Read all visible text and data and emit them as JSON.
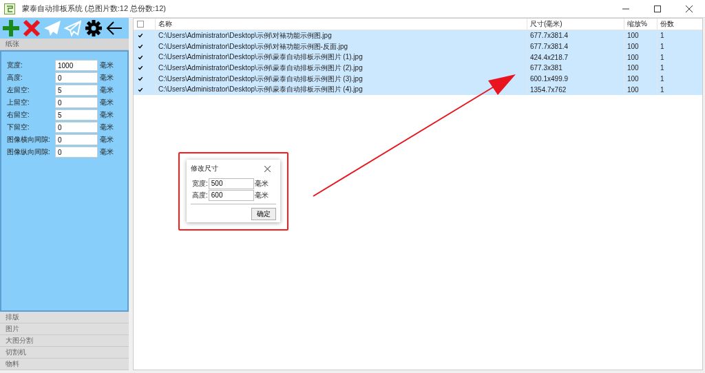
{
  "window": {
    "title": "蒙泰自动排板系统 (总图片数:12 总份数:12)"
  },
  "sidebar": {
    "sections": [
      {
        "label": "纸张",
        "expanded": true,
        "fields": [
          {
            "label": "宽度:",
            "value": "1000",
            "unit": "毫米"
          },
          {
            "label": "高度:",
            "value": "0",
            "unit": "毫米"
          },
          {
            "label": "左留空:",
            "value": "5",
            "unit": "毫米"
          },
          {
            "label": "上留空:",
            "value": "0",
            "unit": "毫米"
          },
          {
            "label": "右留空:",
            "value": "5",
            "unit": "毫米"
          },
          {
            "label": "下留空:",
            "value": "0",
            "unit": "毫米"
          },
          {
            "label": "图像横向间隙:",
            "value": "0",
            "unit": "毫米"
          },
          {
            "label": "图像纵向间隙:",
            "value": "0",
            "unit": "毫米"
          }
        ]
      },
      {
        "label": "排版",
        "expanded": false
      },
      {
        "label": "图片",
        "expanded": false
      },
      {
        "label": "大图分割",
        "expanded": false
      },
      {
        "label": "切割机",
        "expanded": false
      },
      {
        "label": "物料",
        "expanded": false
      }
    ]
  },
  "table": {
    "all_checked": false,
    "columns": [
      "名称",
      "尺寸(毫米)",
      "缩放%",
      "份数"
    ],
    "rows": [
      {
        "checked": true,
        "name": "C:\\Users\\Administrator\\Desktop\\示例\\对裱功能示例图.jpg",
        "size": "677.7x381.4",
        "scale": "100",
        "copies": "1"
      },
      {
        "checked": true,
        "name": "C:\\Users\\Administrator\\Desktop\\示例\\对裱功能示例图-反面.jpg",
        "size": "677.7x381.4",
        "scale": "100",
        "copies": "1"
      },
      {
        "checked": true,
        "name": "C:\\Users\\Administrator\\Desktop\\示例\\蒙泰自动排板示例图片 (1).jpg",
        "size": "424.4x218.7",
        "scale": "100",
        "copies": "1"
      },
      {
        "checked": true,
        "name": "C:\\Users\\Administrator\\Desktop\\示例\\蒙泰自动排板示例图片 (2).jpg",
        "size": "677.3x381",
        "scale": "100",
        "copies": "1"
      },
      {
        "checked": true,
        "name": "C:\\Users\\Administrator\\Desktop\\示例\\蒙泰自动排板示例图片 (3).jpg",
        "size": "600.1x499.9",
        "scale": "100",
        "copies": "1"
      },
      {
        "checked": true,
        "name": "C:\\Users\\Administrator\\Desktop\\示例\\蒙泰自动排板示例图片 (4).jpg",
        "size": "1354.7x762",
        "scale": "100",
        "copies": "1"
      }
    ]
  },
  "dialog": {
    "title": "修改尺寸",
    "fields": [
      {
        "label": "宽度:",
        "value": "500",
        "unit": "毫米"
      },
      {
        "label": "高度:",
        "value": "600",
        "unit": "毫米"
      }
    ],
    "button": "确定"
  }
}
